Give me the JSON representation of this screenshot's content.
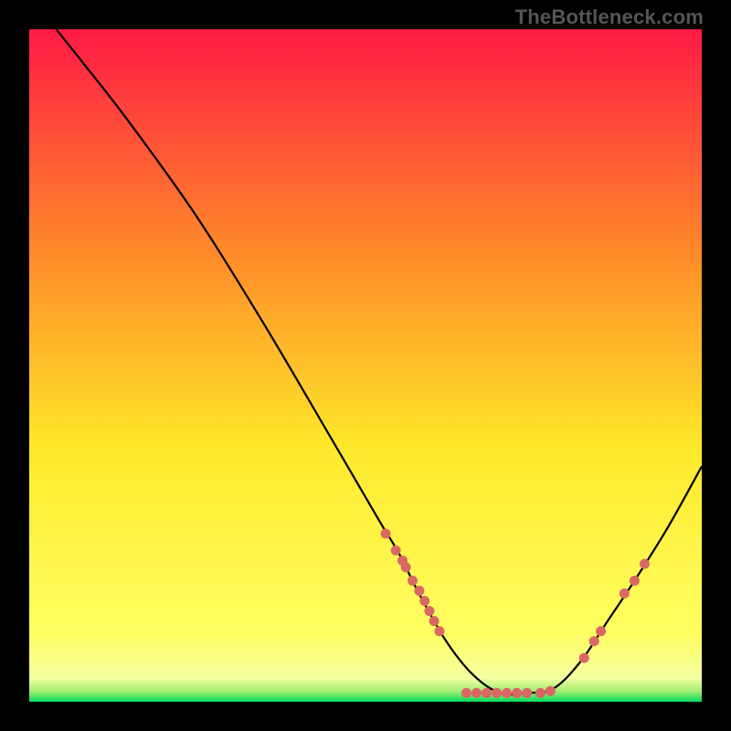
{
  "watermark": "TheBottleneck.com",
  "chart_data": {
    "type": "line",
    "title": "",
    "xlabel": "",
    "ylabel": "",
    "xlim": [
      0,
      100
    ],
    "ylim": [
      0,
      100
    ],
    "background_gradient": {
      "top": "#ff1a45",
      "mid1": "#ff8a2a",
      "mid2": "#ffe82a",
      "mid3": "#ffff62",
      "bottom": "#00db60"
    },
    "curve": [
      {
        "x": 4,
        "y": 100
      },
      {
        "x": 8,
        "y": 95
      },
      {
        "x": 15,
        "y": 86
      },
      {
        "x": 25,
        "y": 72
      },
      {
        "x": 35,
        "y": 56
      },
      {
        "x": 45,
        "y": 39
      },
      {
        "x": 52,
        "y": 27
      },
      {
        "x": 55,
        "y": 22
      },
      {
        "x": 58,
        "y": 16
      },
      {
        "x": 62,
        "y": 9
      },
      {
        "x": 66,
        "y": 4
      },
      {
        "x": 70,
        "y": 1.3
      },
      {
        "x": 74,
        "y": 1.3
      },
      {
        "x": 78,
        "y": 2
      },
      {
        "x": 82,
        "y": 6
      },
      {
        "x": 86,
        "y": 12
      },
      {
        "x": 90,
        "y": 18
      },
      {
        "x": 95,
        "y": 26
      },
      {
        "x": 100,
        "y": 35
      }
    ],
    "markers": [
      {
        "x": 53,
        "y": 25
      },
      {
        "x": 54.5,
        "y": 22.5
      },
      {
        "x": 55.5,
        "y": 21
      },
      {
        "x": 56,
        "y": 20
      },
      {
        "x": 57,
        "y": 18
      },
      {
        "x": 58,
        "y": 16.5
      },
      {
        "x": 58.8,
        "y": 15
      },
      {
        "x": 59.5,
        "y": 13.5
      },
      {
        "x": 60.2,
        "y": 12
      },
      {
        "x": 61,
        "y": 10.5
      },
      {
        "x": 65,
        "y": 1.3
      },
      {
        "x": 66.5,
        "y": 1.3
      },
      {
        "x": 68,
        "y": 1.3
      },
      {
        "x": 69.5,
        "y": 1.3
      },
      {
        "x": 71,
        "y": 1.3
      },
      {
        "x": 72.5,
        "y": 1.3
      },
      {
        "x": 74,
        "y": 1.3
      },
      {
        "x": 76,
        "y": 1.3
      },
      {
        "x": 77.5,
        "y": 1.6
      },
      {
        "x": 82.5,
        "y": 6.5
      },
      {
        "x": 84,
        "y": 9
      },
      {
        "x": 85,
        "y": 10.5
      },
      {
        "x": 88.5,
        "y": 16.1
      },
      {
        "x": 90,
        "y": 18
      },
      {
        "x": 91.5,
        "y": 20.5
      }
    ],
    "marker_color": "#d96864",
    "curve_color": "#000000"
  }
}
